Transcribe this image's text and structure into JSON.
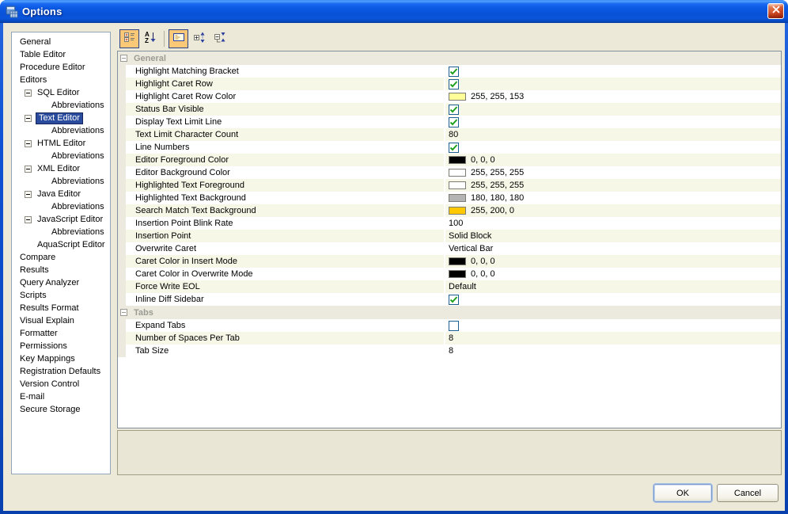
{
  "window": {
    "title": "Options"
  },
  "sidebar": {
    "items": [
      {
        "label": "General",
        "level": 0
      },
      {
        "label": "Table Editor",
        "level": 0
      },
      {
        "label": "Procedure Editor",
        "level": 0
      },
      {
        "label": "Editors",
        "level": 0
      },
      {
        "label": "SQL Editor",
        "level": 1,
        "toggle": "minus"
      },
      {
        "label": "Abbreviations",
        "level": 2
      },
      {
        "label": "Text Editor",
        "level": 1,
        "toggle": "minus",
        "selected": true
      },
      {
        "label": "Abbreviations",
        "level": 2
      },
      {
        "label": "HTML Editor",
        "level": 1,
        "toggle": "minus"
      },
      {
        "label": "Abbreviations",
        "level": 2
      },
      {
        "label": "XML Editor",
        "level": 1,
        "toggle": "minus"
      },
      {
        "label": "Abbreviations",
        "level": 2
      },
      {
        "label": "Java Editor",
        "level": 1,
        "toggle": "minus"
      },
      {
        "label": "Abbreviations",
        "level": 2
      },
      {
        "label": "JavaScript Editor",
        "level": 1,
        "toggle": "minus"
      },
      {
        "label": "Abbreviations",
        "level": 2
      },
      {
        "label": "AquaScript Editor",
        "level": 1
      },
      {
        "label": "Compare",
        "level": 0
      },
      {
        "label": "Results",
        "level": 0
      },
      {
        "label": "Query Analyzer",
        "level": 0
      },
      {
        "label": "Scripts",
        "level": 0
      },
      {
        "label": "Results Format",
        "level": 0
      },
      {
        "label": "Visual Explain",
        "level": 0
      },
      {
        "label": "Formatter",
        "level": 0
      },
      {
        "label": "Permissions",
        "level": 0
      },
      {
        "label": "Key Mappings",
        "level": 0
      },
      {
        "label": "Registration Defaults",
        "level": 0
      },
      {
        "label": "Version Control",
        "level": 0
      },
      {
        "label": "E-mail",
        "level": 0
      },
      {
        "label": "Secure Storage",
        "level": 0
      }
    ]
  },
  "toolbar": {
    "buttons": [
      {
        "icon": "categorized-view-icon",
        "toggled": true
      },
      {
        "icon": "sort-alphabetical-icon",
        "toggled": false
      },
      {
        "icon": "separator"
      },
      {
        "icon": "show-description-icon",
        "toggled": true
      },
      {
        "icon": "expand-all-icon",
        "toggled": false
      },
      {
        "icon": "collapse-all-icon",
        "toggled": false
      }
    ]
  },
  "grid": {
    "sections": [
      {
        "title": "General",
        "rows": [
          {
            "label": "Highlight Matching Bracket",
            "type": "bool",
            "checked": true
          },
          {
            "label": "Highlight Caret Row",
            "type": "bool",
            "checked": true
          },
          {
            "label": "Highlight Caret Row Color",
            "type": "color",
            "swatch": "#ffff99",
            "value": "255, 255, 153"
          },
          {
            "label": "Status Bar Visible",
            "type": "bool",
            "checked": true
          },
          {
            "label": "Display Text Limit Line",
            "type": "bool",
            "checked": true
          },
          {
            "label": "Text Limit Character Count",
            "type": "text",
            "value": "80"
          },
          {
            "label": "Line Numbers",
            "type": "bool",
            "checked": true
          },
          {
            "label": "Editor Foreground Color",
            "type": "color",
            "swatch": "#000000",
            "value": "0, 0, 0"
          },
          {
            "label": "Editor Background Color",
            "type": "color",
            "swatch": "#ffffff",
            "value": "255, 255, 255"
          },
          {
            "label": "Highlighted Text Foreground",
            "type": "color",
            "swatch": "#ffffff",
            "value": "255, 255, 255"
          },
          {
            "label": "Highlighted Text Background",
            "type": "color",
            "swatch": "#b4b4b4",
            "value": "180, 180, 180"
          },
          {
            "label": "Search Match Text Background",
            "type": "color",
            "swatch": "#ffc800",
            "value": "255, 200, 0"
          },
          {
            "label": "Insertion Point Blink Rate",
            "type": "text",
            "value": "100"
          },
          {
            "label": "Insertion Point",
            "type": "text",
            "value": "Solid Block"
          },
          {
            "label": "Overwrite Caret",
            "type": "text",
            "value": "Vertical Bar"
          },
          {
            "label": "Caret Color in Insert Mode",
            "type": "color",
            "swatch": "#000000",
            "value": "0, 0, 0"
          },
          {
            "label": "Caret Color in Overwrite Mode",
            "type": "color",
            "swatch": "#000000",
            "value": "0, 0, 0"
          },
          {
            "label": "Force Write EOL",
            "type": "text",
            "value": "Default"
          },
          {
            "label": "Inline Diff Sidebar",
            "type": "bool",
            "checked": true
          }
        ]
      },
      {
        "title": "Tabs",
        "rows": [
          {
            "label": "Expand Tabs",
            "type": "bool",
            "checked": false
          },
          {
            "label": "Number of Spaces Per Tab",
            "type": "text",
            "value": "8"
          },
          {
            "label": "Tab Size",
            "type": "text",
            "value": "8"
          }
        ]
      }
    ]
  },
  "footer": {
    "ok": "OK",
    "cancel": "Cancel"
  },
  "colors": {
    "selection": "#2b4b9d",
    "row_alt": "#f7f7e7",
    "checkbox_check": "#1fa11f",
    "toolbar_toggle_bg": "#fbc878",
    "titlebar_blue": "#0852d8"
  }
}
